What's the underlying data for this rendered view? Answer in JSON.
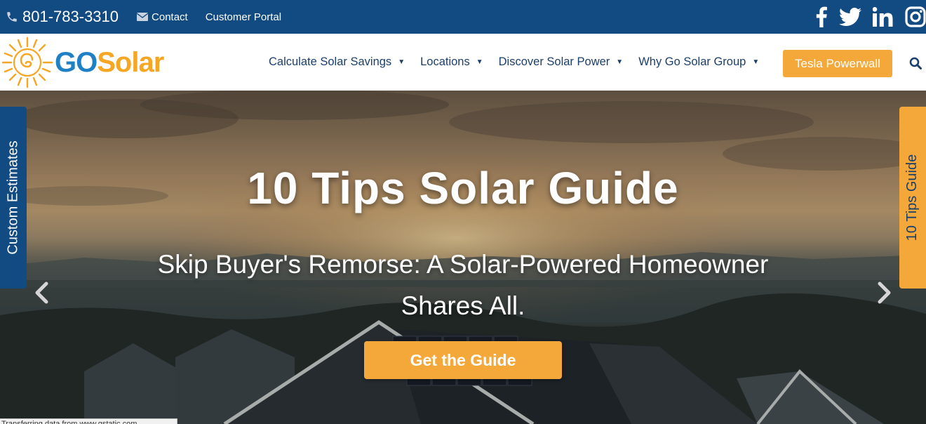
{
  "topbar": {
    "phone": "801-783-3310",
    "contact_label": "Contact",
    "portal_label": "Customer Portal",
    "social": [
      "facebook-icon",
      "twitter-icon",
      "linkedin-icon",
      "instagram-icon"
    ]
  },
  "logo": {
    "go": "GO",
    "solar": "Solar"
  },
  "nav": {
    "items": [
      {
        "label": "Calculate Solar Savings"
      },
      {
        "label": "Locations"
      },
      {
        "label": "Discover Solar Power"
      },
      {
        "label": "Why Go Solar Group"
      }
    ],
    "cta_label": "Tesla Powerwall"
  },
  "hero": {
    "title": "10 Tips Solar Guide",
    "subtitle": "Skip Buyer's Remorse: A Solar-Powered Homeowner Shares All.",
    "button_label": "Get the Guide"
  },
  "side_tabs": {
    "left": "Custom Estimates",
    "right": "10 Tips Guide"
  },
  "status": "Transferring data from www.gstatic.com...",
  "colors": {
    "brand_blue": "#124a82",
    "nav_text": "#1b3f6b",
    "accent_orange": "#f5a83a",
    "logo_blue": "#1f80c6",
    "logo_orange": "#f5a623"
  }
}
